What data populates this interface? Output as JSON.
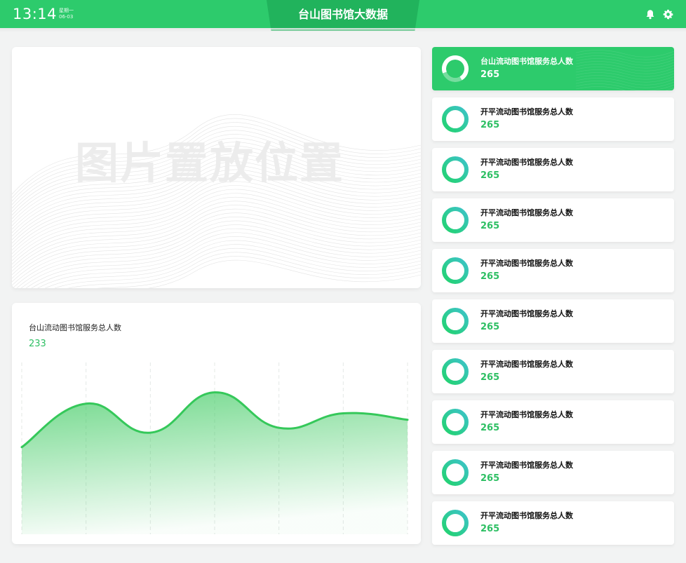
{
  "header": {
    "time": "13:14",
    "weekday": "星期一",
    "date": "06-03",
    "title": "台山图书馆大数据",
    "bell_icon": "bell-icon",
    "settings_icon": "gear-icon"
  },
  "image_placeholder": {
    "text": "图片置放位置"
  },
  "chart_panel": {
    "title": "台山流动图书馆服务总人数",
    "value": "233"
  },
  "chart_data": {
    "type": "area",
    "title": "",
    "xlabel": "",
    "ylabel": "",
    "x": [
      0,
      1,
      2,
      3,
      4,
      5,
      6
    ],
    "values": [
      54,
      81,
      63,
      88,
      66,
      75,
      71
    ],
    "ylim": [
      0,
      100
    ],
    "grid": "vertical dashed",
    "color": "#35c85a"
  },
  "cards": [
    {
      "label": "台山流动图书馆服务总人数",
      "value": "265",
      "active": true
    },
    {
      "label": "开平流动图书馆服务总人数",
      "value": "265",
      "active": false
    },
    {
      "label": "开平流动图书馆服务总人数",
      "value": "265",
      "active": false
    },
    {
      "label": "开平流动图书馆服务总人数",
      "value": "265",
      "active": false
    },
    {
      "label": "开平流动图书馆服务总人数",
      "value": "265",
      "active": false
    },
    {
      "label": "开平流动图书馆服务总人数",
      "value": "265",
      "active": false
    },
    {
      "label": "开平流动图书馆服务总人数",
      "value": "265",
      "active": false
    },
    {
      "label": "开平流动图书馆服务总人数",
      "value": "265",
      "active": false
    },
    {
      "label": "开平流动图书馆服务总人数",
      "value": "265",
      "active": false
    },
    {
      "label": "开平流动图书馆服务总人数",
      "value": "265",
      "active": false
    }
  ],
  "colors": {
    "accent": "#2dcb6c",
    "accent_dark": "#21b35c",
    "value_green": "#2dbf63",
    "ring_cyan": "#3cc3c8"
  }
}
